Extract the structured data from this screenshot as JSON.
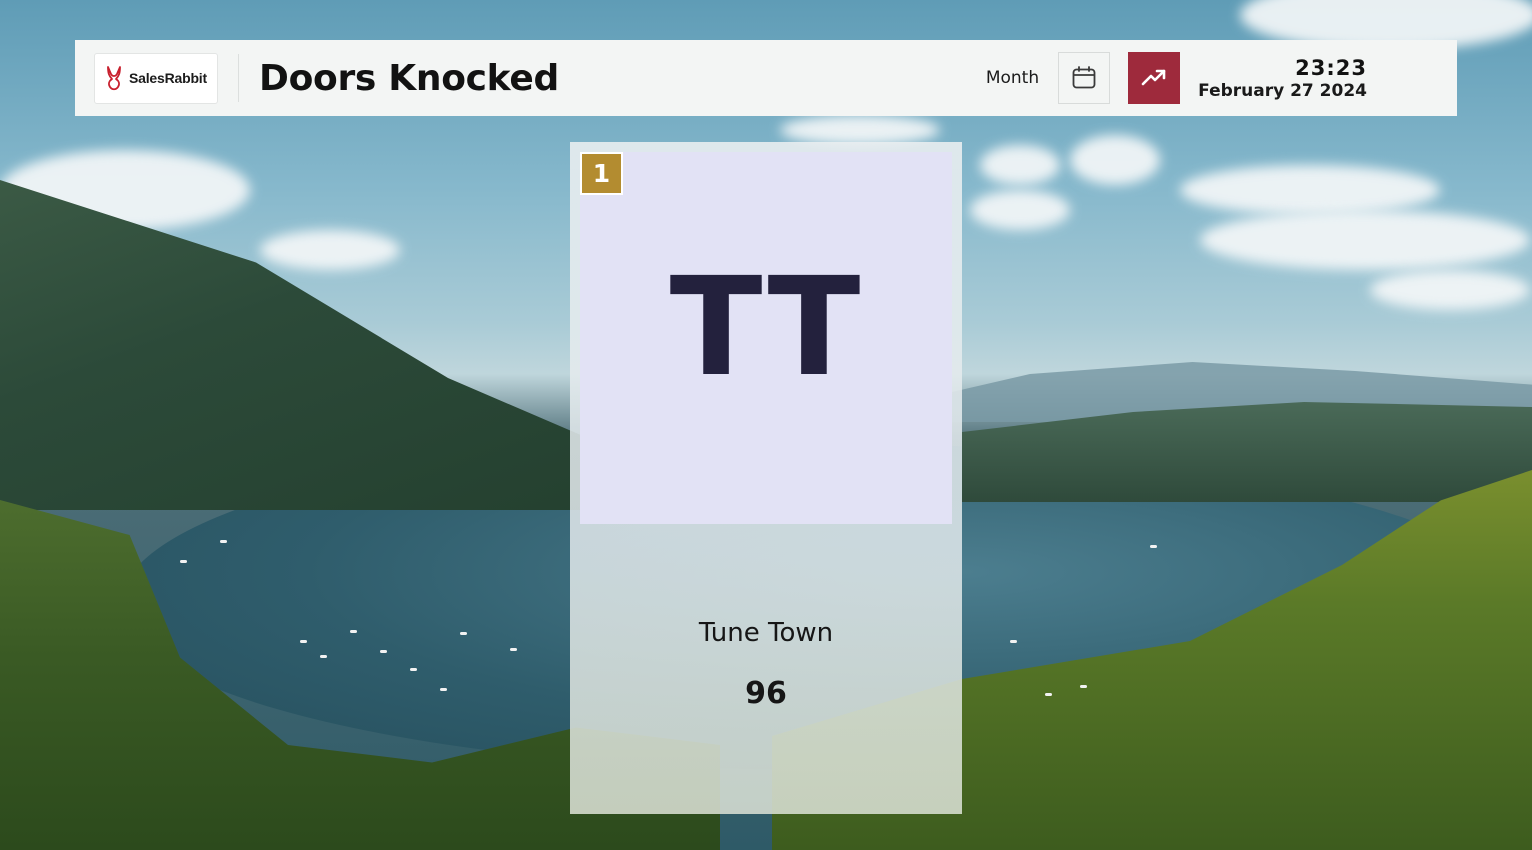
{
  "header": {
    "logo_text": "SalesRabbit",
    "title": "Doors Knocked",
    "period_label": "Month",
    "time": "23:23",
    "date": "February 27 2024",
    "accent_color": "#9e2a3c"
  },
  "icons": {
    "logo": "rabbit-logo-icon",
    "calendar": "calendar-icon",
    "trend": "trending-up-icon"
  },
  "leaderboard": [
    {
      "rank": "1",
      "initials": "TT",
      "name": "Tune Town",
      "score": "96",
      "rank_color": "#b38c30"
    }
  ]
}
